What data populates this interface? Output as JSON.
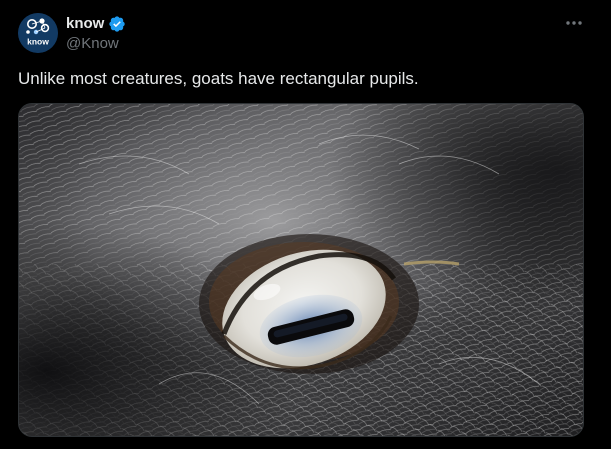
{
  "author": {
    "display_name": "know",
    "handle": "@Know",
    "verified": true,
    "avatar_text": "know"
  },
  "tweet": {
    "text": "Unlike most creatures, goats have rectangular pupils."
  },
  "media": {
    "icon": "goat-eye-photo",
    "alt": "Close-up of a goat's eye with a rectangular pupil"
  },
  "colors": {
    "background": "#000000",
    "text_primary": "#e7e9ea",
    "text_secondary": "#71767b",
    "verified": "#1d9bf0",
    "border": "#2f3336"
  }
}
